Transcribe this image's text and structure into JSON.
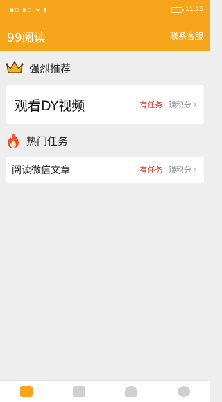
{
  "status_bar": {
    "left": "▪▫ ▪▫ ≈ ▮",
    "time": "11:25"
  },
  "header": {
    "title": "99阅读",
    "contact": "联系客服"
  },
  "sections": [
    {
      "title": "强烈推荐",
      "icon": "crown-icon",
      "items": [
        {
          "label": "观看DY视频",
          "task_tag": "有任务!",
          "earn_label": "赚积分"
        }
      ]
    },
    {
      "title": "热门任务",
      "icon": "flame-icon",
      "items": [
        {
          "label": "阅读微信文章",
          "task_tag": "有任务!",
          "earn_label": "赚积分"
        }
      ]
    }
  ],
  "colors": {
    "brand": "#f6a41a",
    "task_text": "#d43e2a"
  },
  "tabs": [
    {
      "icon": "home-icon",
      "active": true
    },
    {
      "icon": "message-icon",
      "active": false
    },
    {
      "icon": "user-icon",
      "active": false
    },
    {
      "icon": "compass-icon",
      "active": false
    }
  ]
}
